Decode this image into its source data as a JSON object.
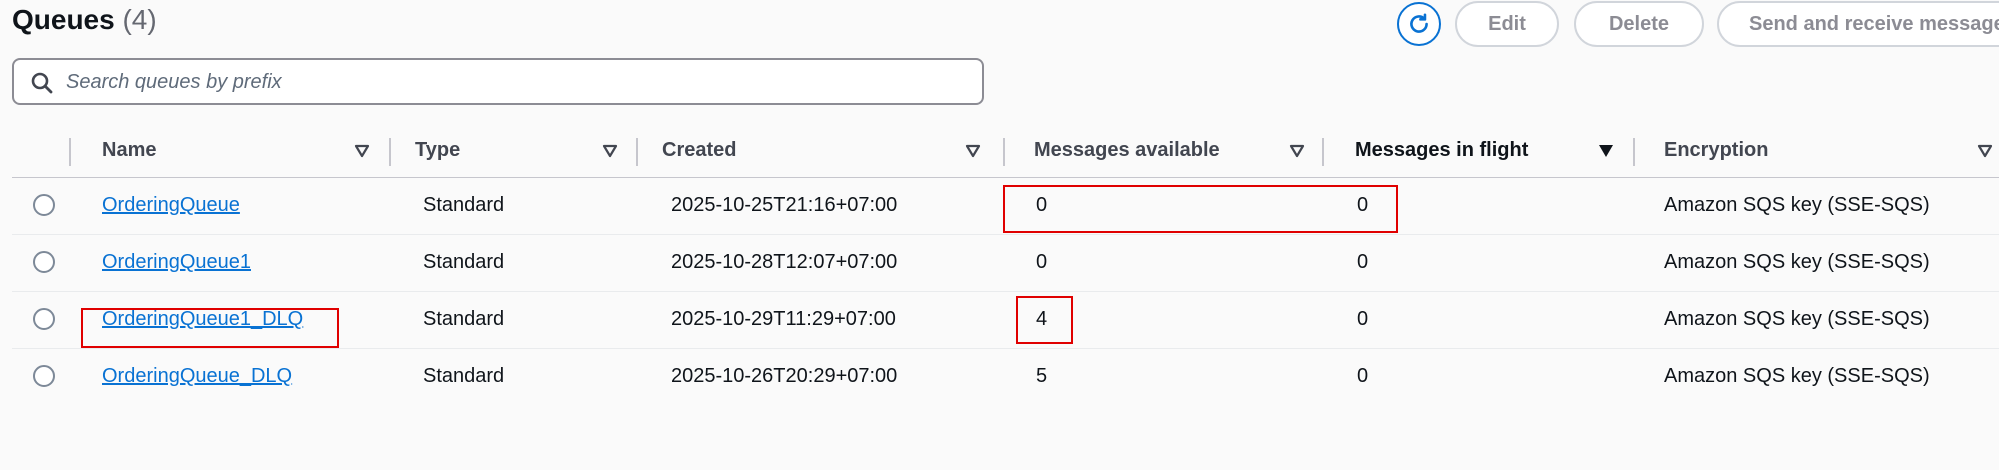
{
  "header": {
    "title": "Queues",
    "count": "(4)"
  },
  "toolbar": {
    "edit_label": "Edit",
    "delete_label": "Delete",
    "send_label": "Send and receive messages"
  },
  "search": {
    "placeholder": "Search queues by prefix",
    "value": ""
  },
  "table": {
    "columns": [
      "Name",
      "Type",
      "Created",
      "Messages available",
      "Messages in flight",
      "Encryption"
    ],
    "rows": [
      {
        "name": "OrderingQueue",
        "type": "Standard",
        "created": "2025-10-25T21:16+07:00",
        "available": "0",
        "inflight": "0",
        "encryption": "Amazon SQS key (SSE-SQS)"
      },
      {
        "name": "OrderingQueue1",
        "type": "Standard",
        "created": "2025-10-28T12:07+07:00",
        "available": "0",
        "inflight": "0",
        "encryption": "Amazon SQS key (SSE-SQS)"
      },
      {
        "name": "OrderingQueue1_DLQ",
        "type": "Standard",
        "created": "2025-10-29T11:29+07:00",
        "available": "4",
        "inflight": "0",
        "encryption": "Amazon SQS key (SSE-SQS)"
      },
      {
        "name": "OrderingQueue_DLQ",
        "type": "Standard",
        "created": "2025-10-26T20:29+07:00",
        "available": "5",
        "inflight": "0",
        "encryption": "Amazon SQS key (SSE-SQS)"
      }
    ]
  },
  "colors": {
    "accent": "#0972d3",
    "annotation": "#e00000"
  },
  "icons": [
    "refresh-icon",
    "search-icon",
    "sort-icon"
  ]
}
